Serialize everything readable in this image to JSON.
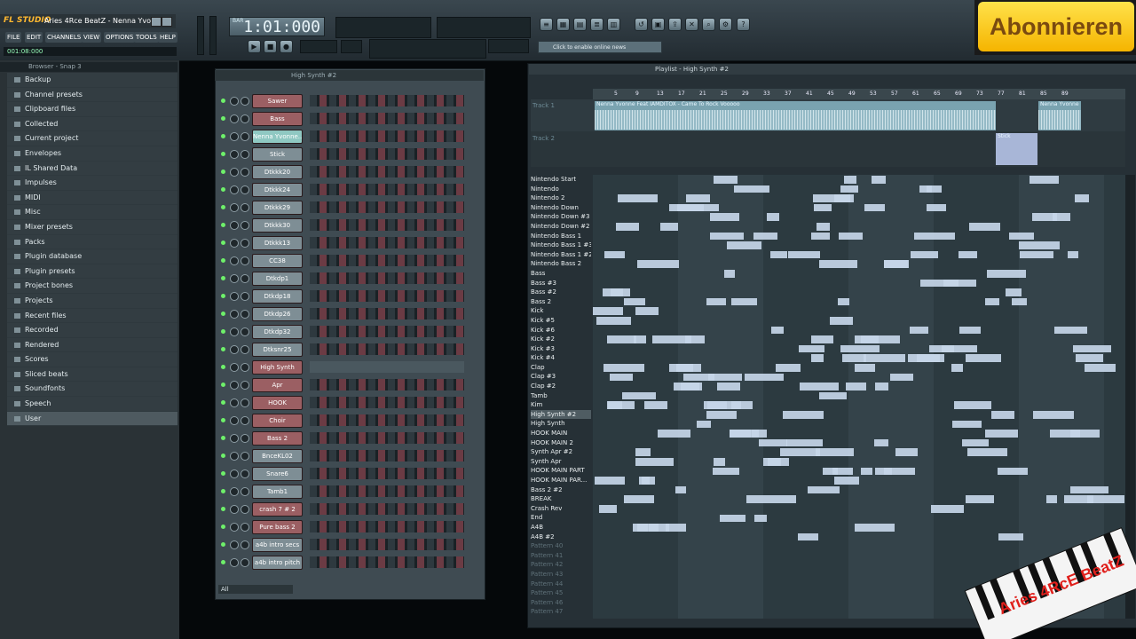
{
  "app": {
    "logo": "FL STUDIO",
    "window_title": "Aries 4Rce BeatZ - Nenna Yvo..."
  },
  "menu": [
    "FILE",
    "EDIT",
    "CHANNELS",
    "VIEW",
    "OPTIONS",
    "TOOLS",
    "HELP"
  ],
  "time_small": "001:08:000",
  "lcd": {
    "label": "BAR",
    "value": "1:01:000"
  },
  "hint": "Click to enable online news",
  "subscribe": "Abonnieren",
  "browser": {
    "header": "Browser - Snap 3",
    "items": [
      "Backup",
      "Channel presets",
      "Clipboard files",
      "Collected",
      "Current project",
      "Envelopes",
      "IL Shared Data",
      "Impulses",
      "MIDI",
      "Misc",
      "Mixer presets",
      "Packs",
      "Plugin database",
      "Plugin presets",
      "Project bones",
      "Projects",
      "Recent files",
      "Recorded",
      "Rendered",
      "Scores",
      "Sliced beats",
      "Soundfonts",
      "Speech",
      "User"
    ],
    "selected": "User"
  },
  "sequencer": {
    "title": "High Synth #2",
    "footer": "All",
    "channels": [
      "Sawer",
      "Bass",
      "Nenna Yvonne...",
      "Stick",
      "Dtkkk20",
      "Dtkkk24",
      "Dtkkk29",
      "Dtkkk30",
      "Dtkkk13",
      "CC38",
      "Dtkdp1",
      "Dtkdp18",
      "Dtkdp26",
      "Dtkdp32",
      "Dtksnr25",
      "High Synth",
      "Apr",
      "HOOK",
      "Choir",
      "Bass 2",
      "BnceKL02",
      "Snare6",
      "Tamb1",
      "crash 7 # 2",
      "Pure bass 2",
      "a4b intro secs",
      "a4b intro pitch"
    ]
  },
  "playlist": {
    "title": "Playlist - High Synth #2",
    "ruler": [
      "5",
      "9",
      "13",
      "17",
      "21",
      "25",
      "29",
      "33",
      "37",
      "41",
      "45",
      "49",
      "53",
      "57",
      "61",
      "65",
      "69",
      "73",
      "77",
      "81",
      "85",
      "89"
    ],
    "tracks": [
      "Track 1",
      "Track 2"
    ],
    "clips": [
      "Nenna Yvonne Feat IAMDITOX - Came To Rock Vooooo",
      "Nenna Yvonne",
      "Stick"
    ],
    "patterns": [
      "Nintendo Start",
      "Nintendo",
      "Nintendo 2",
      "Nintendo Down",
      "Nintendo Down #3",
      "Nintendo Down #2",
      "Nintendo Bass 1",
      "Nintendo Bass 1 #3",
      "Nintendo Bass 1 #2",
      "Nintendo Bass 2",
      "Bass",
      "Bass #3",
      "Bass #2",
      "Bass 2",
      "Kick",
      "Kick #5",
      "Kick #6",
      "Kick #2",
      "Kick #3",
      "Kick #4",
      "Clap",
      "Clap #3",
      "Clap #2",
      "Tamb",
      "Kim",
      "High Synth #2",
      "High Synth",
      "HOOK MAIN",
      "HOOK MAIN 2",
      "Synth Apr #2",
      "Synth Apr",
      "HOOK MAIN PART",
      "HOOK MAIN PAR...",
      "Bass 2 #2",
      "BREAK",
      "Crash Rev",
      "End",
      "A4B",
      "A4B #2",
      "Pattern 40",
      "Pattern 41",
      "Pattern 42",
      "Pattern 43",
      "Pattern 44",
      "Pattern 45",
      "Pattern 46",
      "Pattern 47"
    ],
    "selected_pattern": "High Synth #2"
  },
  "watermark": "Aries 4RcE BeatZ"
}
